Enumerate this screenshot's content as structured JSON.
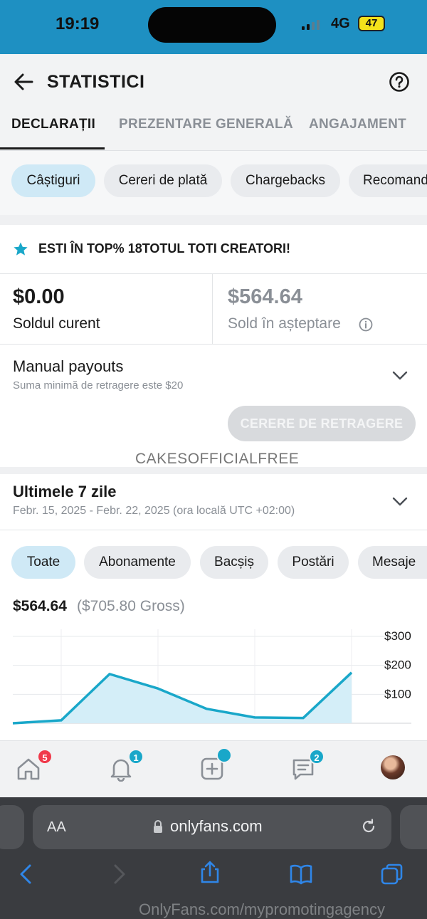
{
  "status_bar": {
    "time": "19:19",
    "network": "4G",
    "battery": "47"
  },
  "header": {
    "title": "STATISTICI"
  },
  "tabs": [
    {
      "label": "DECLARAȚII",
      "active": true
    },
    {
      "label": "PREZENTARE GENERALĂ",
      "active": false
    },
    {
      "label": "ANGAJAMENT",
      "active": false
    }
  ],
  "filter_chips": [
    {
      "label": "Câștiguri",
      "active": true
    },
    {
      "label": "Cereri de plată",
      "active": false
    },
    {
      "label": "Chargebacks",
      "active": false
    },
    {
      "label": "Recomand",
      "active": false
    }
  ],
  "top_banner": {
    "text": "ESTI ÎN TOP% 18TOTUL TOTI CREATORI!"
  },
  "balances": {
    "current": {
      "amount": "$0.00",
      "label": "Soldul curent"
    },
    "pending": {
      "amount": "$564.64",
      "label": "Sold în așteptare"
    }
  },
  "payouts": {
    "title": "Manual payouts",
    "subtitle": "Suma minimă de retragere este $20",
    "button_label": "CERERE DE RETRAGERE"
  },
  "watermark_username": "CAKESOFFICIALFREE",
  "period": {
    "title": "Ultimele 7 zile",
    "range": "Febr. 15, 2025 - Febr. 22, 2025 (ora locală UTC +02:00)"
  },
  "category_chips": [
    {
      "label": "Toate",
      "active": true
    },
    {
      "label": "Abonamente",
      "active": false
    },
    {
      "label": "Bacșiș",
      "active": false
    },
    {
      "label": "Postări",
      "active": false
    },
    {
      "label": "Mesaje",
      "active": false
    }
  ],
  "totals": {
    "net": "$564.64",
    "gross": "($705.80 Gross)"
  },
  "chart_data": {
    "type": "area",
    "x": [
      0,
      1,
      2,
      3,
      4,
      5,
      6,
      7
    ],
    "values": [
      0,
      10,
      170,
      120,
      50,
      20,
      18,
      175
    ],
    "yticks": [
      "$300",
      "$200",
      "$100"
    ],
    "ylim": [
      0,
      300
    ],
    "line_color": "#19a7c9",
    "fill_color": "#d4eef8",
    "grid": true
  },
  "bottom_nav": {
    "items": [
      {
        "icon": "home-icon",
        "badge": "5",
        "badge_color": "#f0394a"
      },
      {
        "icon": "bell-icon",
        "badge": "1",
        "badge_color": "#19a7c9"
      },
      {
        "icon": "add-post-icon",
        "badge": "",
        "badge_color": "#19a7c9"
      },
      {
        "icon": "messages-icon",
        "badge": "2",
        "badge_color": "#19a7c9"
      },
      {
        "icon": "avatar",
        "badge": "",
        "badge_color": ""
      }
    ]
  },
  "browser": {
    "aa_label": "AA",
    "url": "onlyfans.com"
  },
  "watermark_bottom": "OnlyFans.com/mypromotingagency",
  "colors": {
    "accent": "#19a7c9",
    "status_bar": "#1e90c2",
    "chip_active": "#cfe9f6"
  }
}
